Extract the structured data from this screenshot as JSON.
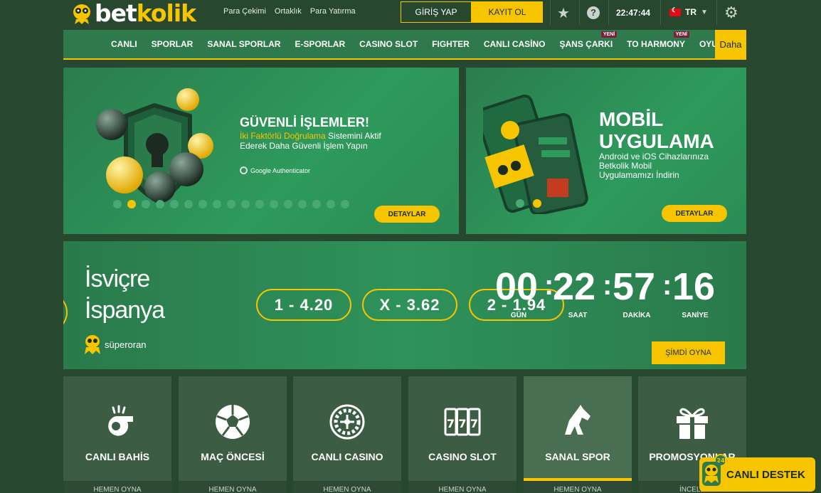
{
  "brand": {
    "name_part1": "bet",
    "name_part2": "kolik"
  },
  "header": {
    "links": [
      "Para Çekimi",
      "Ortaklık",
      "Para Yatırma"
    ],
    "login_label": "GİRİŞ YAP",
    "register_label": "KAYIT OL",
    "time": "22:47:44",
    "language": "TR"
  },
  "nav": {
    "items": [
      {
        "label": "CANLI"
      },
      {
        "label": "SPORLAR"
      },
      {
        "label": "SANAL SPORLAR"
      },
      {
        "label": "E-SPORLAR"
      },
      {
        "label": "CASINO SLOT"
      },
      {
        "label": "FIGHTER"
      },
      {
        "label": "CANLI CASİNO"
      },
      {
        "label": "ŞANS ÇARKI",
        "badge": "YENİ"
      },
      {
        "label": "TO HARMONY",
        "badge": "YENİ"
      },
      {
        "label": "OYUNLAR"
      }
    ],
    "more_label": "Daha"
  },
  "banner_security": {
    "title": "GÜVENLİ İŞLEMLER!",
    "highlight": "İki Faktörlü Doğrulama",
    "line1_rest": " Sistemini Aktif",
    "line2": "Ederek Daha Güvenli İşlem Yapın",
    "authenticator": "Google Authenticator",
    "button": "DETAYLAR",
    "slide_count": 17,
    "active_slide": 2
  },
  "banner_mobile": {
    "title_line1": "MOBİL",
    "title_line2": "UYGULAMA",
    "desc": [
      "Android ve iOS Cihazlarınıza",
      "Betkolik Mobil",
      "Uygulamamızı İndirin"
    ],
    "button": "DETAYLAR",
    "slide_count": 2,
    "active_slide": 2
  },
  "match": {
    "team_home": "İsviçre",
    "team_away": "İspanya",
    "promo": "süperoran",
    "odds": [
      "1 - 4.20",
      "X - 3.62",
      "2 - 1.94"
    ],
    "countdown": {
      "days": "00",
      "hours": "22",
      "minutes": "57",
      "seconds": "16",
      "days_label": "GÜN",
      "hours_label": "SAAT",
      "minutes_label": "DAKİKA",
      "seconds_label": "SANİYE"
    },
    "play_button": "ŞİMDİ OYNA"
  },
  "tiles": [
    {
      "label": "CANLI BAHİS",
      "foot": "HEMEN OYNA",
      "icon": "whistle-icon"
    },
    {
      "label": "MAÇ ÖNCESİ",
      "foot": "HEMEN OYNA",
      "icon": "soccer-ball-icon"
    },
    {
      "label": "CANLI CASINO",
      "foot": "HEMEN OYNA",
      "icon": "roulette-icon"
    },
    {
      "label": "CASINO SLOT",
      "foot": "HEMEN OYNA",
      "icon": "slot-machine-icon"
    },
    {
      "label": "SANAL SPOR",
      "foot": "HEMEN OYNA",
      "icon": "horse-icon"
    },
    {
      "label": "PROMOSYONLAR",
      "foot": "İNCELE",
      "icon": "gift-icon"
    }
  ],
  "support": {
    "label": "CANLI DESTEK",
    "badge": "24"
  },
  "colors": {
    "accent": "#f7c400",
    "nav": "#2f7a4d",
    "bg": "#27472f"
  }
}
